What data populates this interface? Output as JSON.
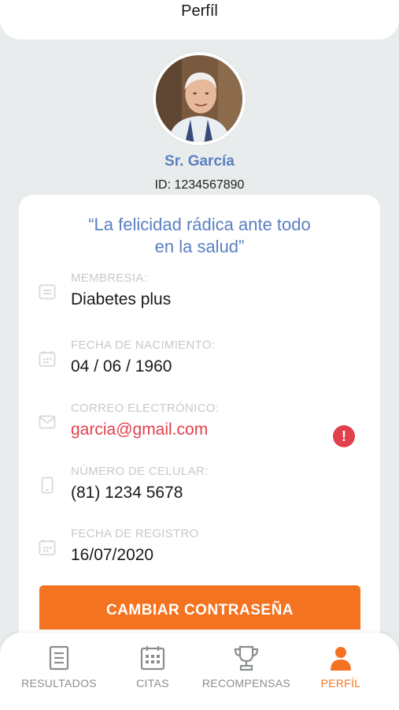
{
  "header": {
    "title": "Perfíl"
  },
  "profile": {
    "name": "Sr. García",
    "id_text": "ID: 1234567890"
  },
  "quote": {
    "line1": "“La felicidad rádica ante todo",
    "line2": "en la salud”"
  },
  "fields": {
    "membership": {
      "label": "MEMBRESIA:",
      "value": "Diabetes plus"
    },
    "birthdate": {
      "label": "FECHA DE NACIMIENTO:",
      "value": "04 / 06 / 1960"
    },
    "email": {
      "label": "CORREO ELECTRÓNICO:",
      "value": "garcia@gmail.com",
      "alert": "!"
    },
    "phone": {
      "label": "NÚMERO DE CELULAR:",
      "value": "(81) 1234 5678"
    },
    "registered": {
      "label": "FECHA DE REGISTRO",
      "value": "16/07/2020"
    }
  },
  "actions": {
    "change_password": "CAMBIAR CONTRASEÑA"
  },
  "tabs": {
    "results": "RESULTADOS",
    "appointments": "CITAS",
    "rewards": "RECOMPENSAS",
    "profile": "PERFÍL",
    "active": "profile"
  },
  "colors": {
    "accent": "#f47321",
    "brand_blue": "#5b80c1",
    "error": "#e2404c",
    "background": "#e8ecec"
  },
  "icons": {
    "membership": "card-icon",
    "birthdate": "calendar-icon",
    "email": "mail-icon",
    "phone": "phone-icon",
    "registered": "calendar-icon",
    "alert": "alert-icon"
  }
}
